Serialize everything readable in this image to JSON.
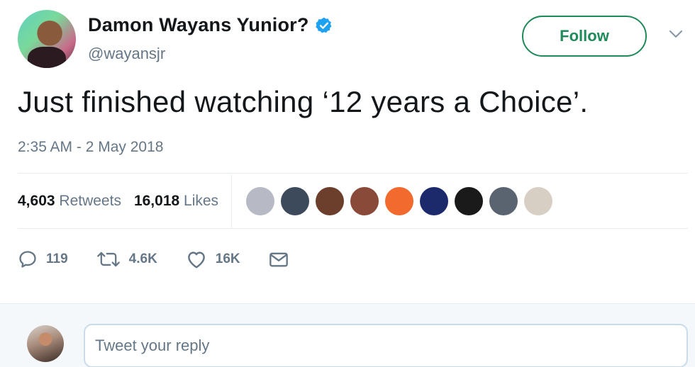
{
  "author": {
    "display_name": "Damon Wayans Yunior?",
    "handle": "@wayansjr",
    "verified": true,
    "verified_icon": "verified-badge-icon"
  },
  "follow_button": {
    "label": "Follow"
  },
  "menu": {
    "icon": "chevron-down-icon"
  },
  "tweet": {
    "text": "Just finished watching ‘12 years a Choice’.",
    "timestamp": "2:35 AM - 2 May 2018"
  },
  "stats": {
    "retweets_count": "4,603",
    "retweets_label": "Retweets",
    "likes_count": "16,018",
    "likes_label": "Likes"
  },
  "likers": [
    {
      "name": "liker-1",
      "color": "#b7b9c4"
    },
    {
      "name": "liker-2",
      "color": "#3d4a5c"
    },
    {
      "name": "liker-3",
      "color": "#6b3f2b"
    },
    {
      "name": "liker-4",
      "color": "#8a4a3a"
    },
    {
      "name": "liker-5",
      "color": "#f26a2e"
    },
    {
      "name": "liker-6",
      "color": "#1c2a6b"
    },
    {
      "name": "liker-7",
      "color": "#1a1a1a"
    },
    {
      "name": "liker-8",
      "color": "#5a6470"
    },
    {
      "name": "liker-9",
      "color": "#d8cfc4"
    }
  ],
  "actions": {
    "reply": {
      "icon": "reply-icon",
      "count": "119"
    },
    "retweet": {
      "icon": "retweet-icon",
      "count": "4.6K"
    },
    "like": {
      "icon": "heart-icon",
      "count": "16K"
    },
    "message": {
      "icon": "envelope-icon"
    }
  },
  "reply_box": {
    "placeholder": "Tweet your reply"
  },
  "colors": {
    "accent_green": "#1f8a5a",
    "verified_blue": "#1da1f2",
    "secondary_text": "#657786",
    "divider": "#e6ecf0"
  }
}
